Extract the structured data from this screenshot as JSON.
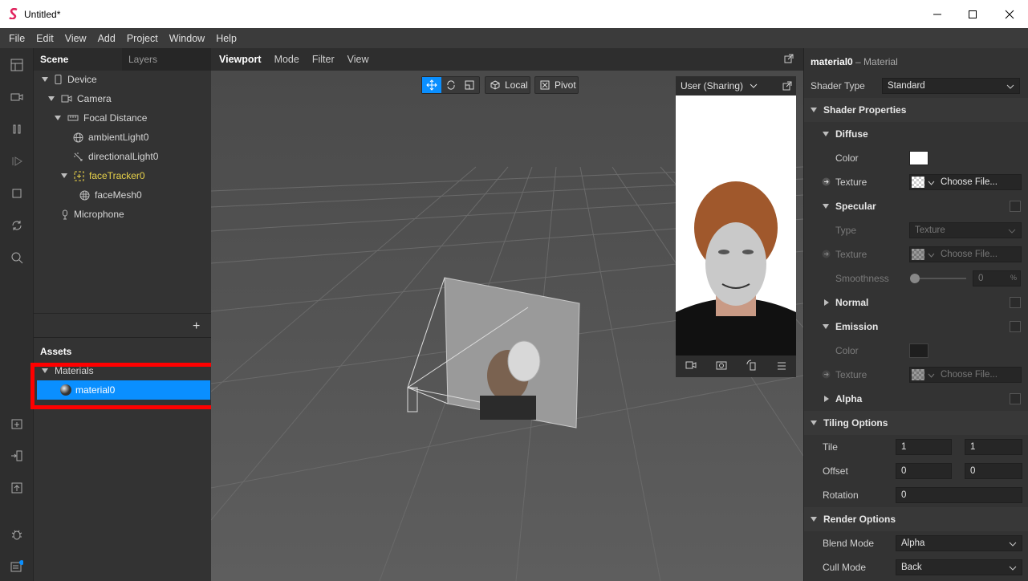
{
  "window": {
    "title": "Untitled*"
  },
  "menu": [
    "File",
    "Edit",
    "View",
    "Add",
    "Project",
    "Window",
    "Help"
  ],
  "scene": {
    "tab_scene": "Scene",
    "tab_layers": "Layers",
    "tree": [
      "Device",
      "Camera",
      "Focal Distance",
      "ambientLight0",
      "directionalLight0",
      "faceTracker0",
      "faceMesh0",
      "Microphone"
    ],
    "add": "+"
  },
  "assets": {
    "title": "Assets",
    "group": "Materials",
    "item": "material0"
  },
  "viewport": {
    "tabs": [
      "Viewport",
      "Mode",
      "Filter",
      "View"
    ],
    "local": "Local",
    "pivot": "Pivot",
    "preview_device": "User (Sharing)"
  },
  "props": {
    "name": "material0",
    "type_suffix": "– Material",
    "shader_type_label": "Shader Type",
    "shader_type": "Standard",
    "shader_props": "Shader Properties",
    "diffuse": "Diffuse",
    "color": "Color",
    "texture": "Texture",
    "choose_file": "Choose File...",
    "specular": "Specular",
    "type": "Type",
    "type_value": "Texture",
    "smoothness": "Smoothness",
    "smooth_val": "0",
    "pct": "%",
    "normal": "Normal",
    "emission": "Emission",
    "alpha": "Alpha",
    "tiling": "Tiling Options",
    "tile": "Tile",
    "tile_x": "1",
    "tile_y": "1",
    "offset": "Offset",
    "off_x": "0",
    "off_y": "0",
    "rotation": "Rotation",
    "rot": "0",
    "render": "Render Options",
    "blend_mode": "Blend Mode",
    "blend_val": "Alpha",
    "cull_mode": "Cull Mode",
    "cull_val": "Back"
  },
  "colors": {
    "accent": "#0a8fff",
    "highlight": "#ff0000",
    "selected_text": "#e8d24a"
  }
}
